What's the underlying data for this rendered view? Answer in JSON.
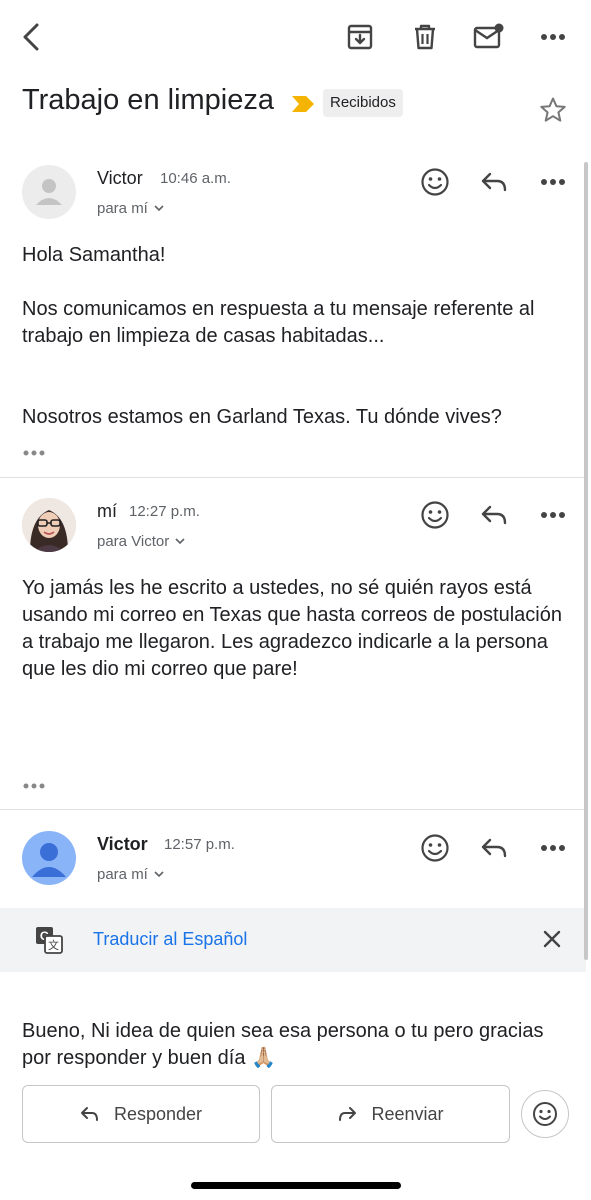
{
  "header": {
    "subject": "Trabajo en limpieza",
    "label": "Recibidos",
    "icons": [
      "back-arrow-icon",
      "archive-icon",
      "trash-icon",
      "mark-unread-icon",
      "more-horizontal-icon",
      "star-icon"
    ]
  },
  "messages": [
    {
      "sender": "Victor",
      "time": "10:46 a.m.",
      "recipient": "para mí",
      "body": "Hola Samantha!\n\nNos comunicamos en respuesta a tu mensaje referente al trabajo en limpieza de casas habitadas...\n\n\nNosotros estamos en Garland Texas.   Tu dónde vives?"
    },
    {
      "sender": "mí",
      "time": "12:27 p.m.",
      "recipient": "para Victor",
      "body": "Yo jamás les he escrito a ustedes, no sé quién rayos está usando mi correo en Texas que hasta correos de postulación a trabajo me llegaron. Les agradezco indicarle a la persona que les dio mi correo que pare!"
    },
    {
      "sender": "Victor",
      "time": "12:57 p.m.",
      "recipient": "para mí",
      "body": "Bueno, Ni idea de quien sea esa persona o tu pero gracias por responder y buen día 🙏🏼"
    }
  ],
  "translate": {
    "link": "Traducir al Español"
  },
  "actions": {
    "reply": "Responder",
    "forward": "Reenviar"
  },
  "colors": {
    "accent": "#1a73e8",
    "label_marker": "#f4b400",
    "icon": "#5f6368"
  }
}
